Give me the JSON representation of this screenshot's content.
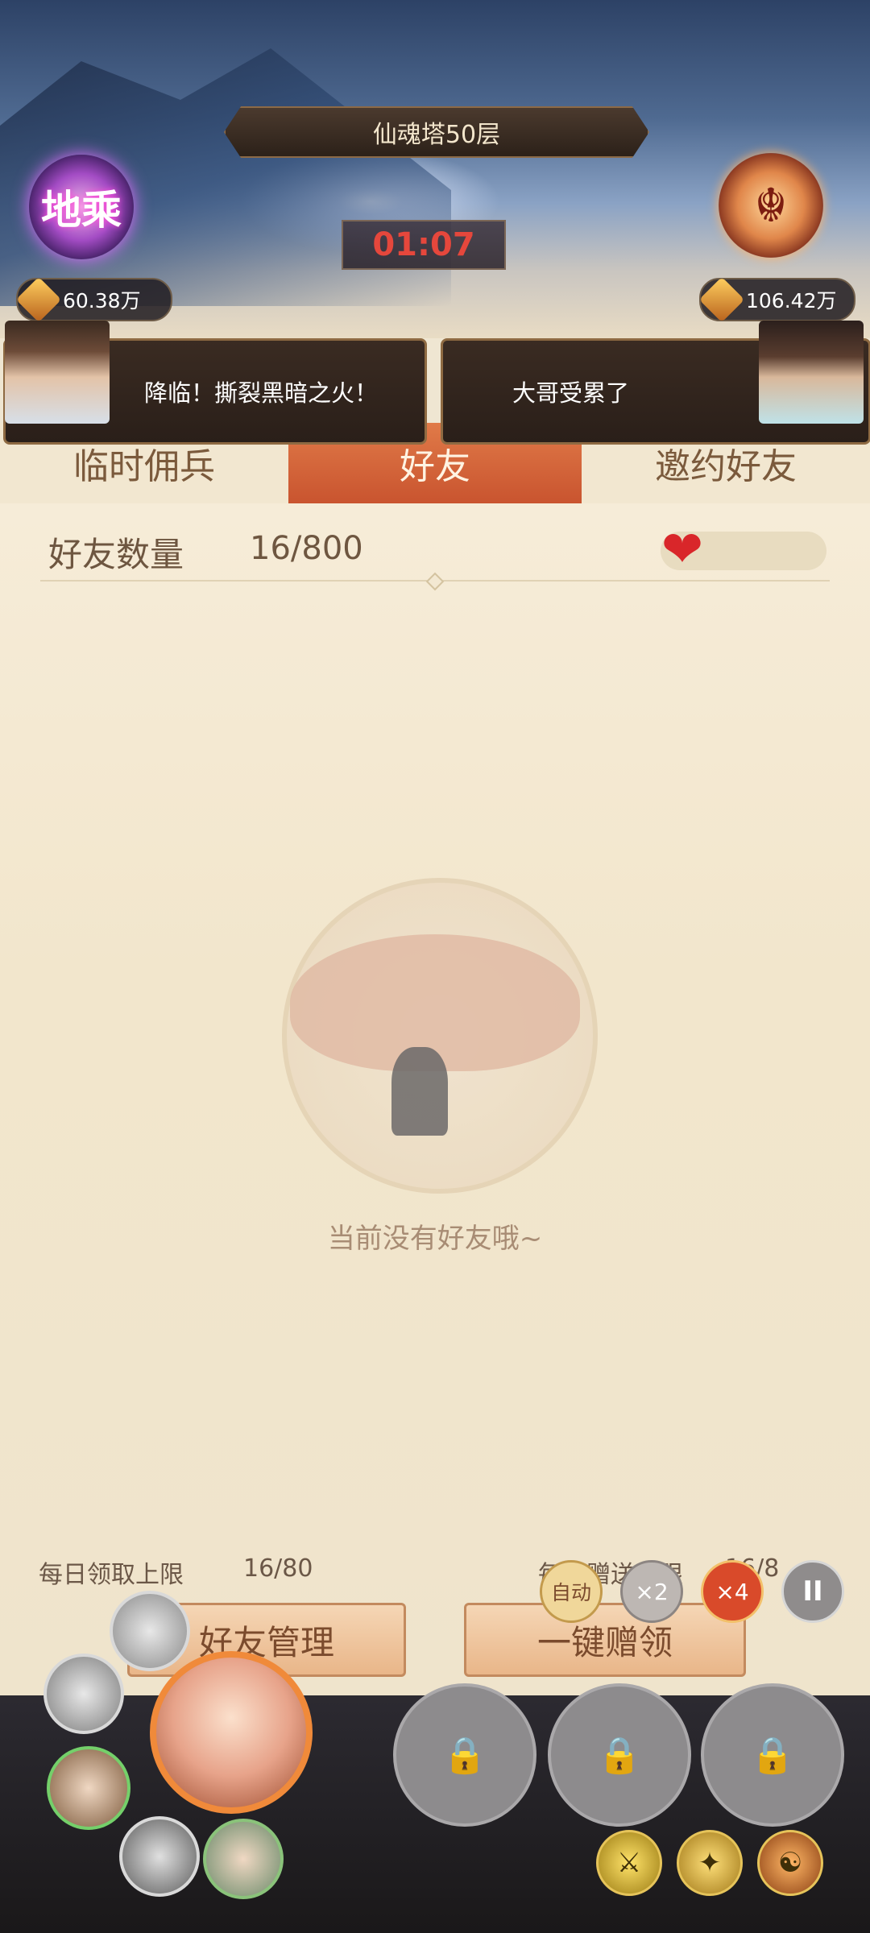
{
  "battle": {
    "title": "仙魂塔50层",
    "timer": "01:07",
    "left_emblem_text": "地乘",
    "left_power": "60.38万",
    "right_power": "106.42万",
    "left_emblem_icon": "rank-emblem-icon",
    "right_emblem_icon": "demon-emblem-icon"
  },
  "chat": {
    "left": "降临！撕裂黑暗之火！",
    "right": "大哥受累了"
  },
  "tabs": [
    {
      "label": "临时佣兵"
    },
    {
      "label": "好友",
      "active": true
    },
    {
      "label": "邀约好友"
    }
  ],
  "friends": {
    "count_label": "好友数量",
    "count_value": "16/800",
    "empty_message": "当前没有好友哦~"
  },
  "limits": {
    "receive_label": "每日领取上限",
    "receive_value": "16/80",
    "give_label": "每日赠送上限",
    "give_value": "16/8"
  },
  "buttons": {
    "manage": "好友管理",
    "one_click": "一键赠领"
  },
  "speed": {
    "auto": "自动",
    "x2": "×2",
    "x4": "×4",
    "pause": "II"
  },
  "skills": [
    "⚔",
    "✦",
    "☯"
  ],
  "colors": {
    "active_tab": "#d9643a",
    "timer": "#e5473c",
    "accent": "#c38a5e"
  }
}
